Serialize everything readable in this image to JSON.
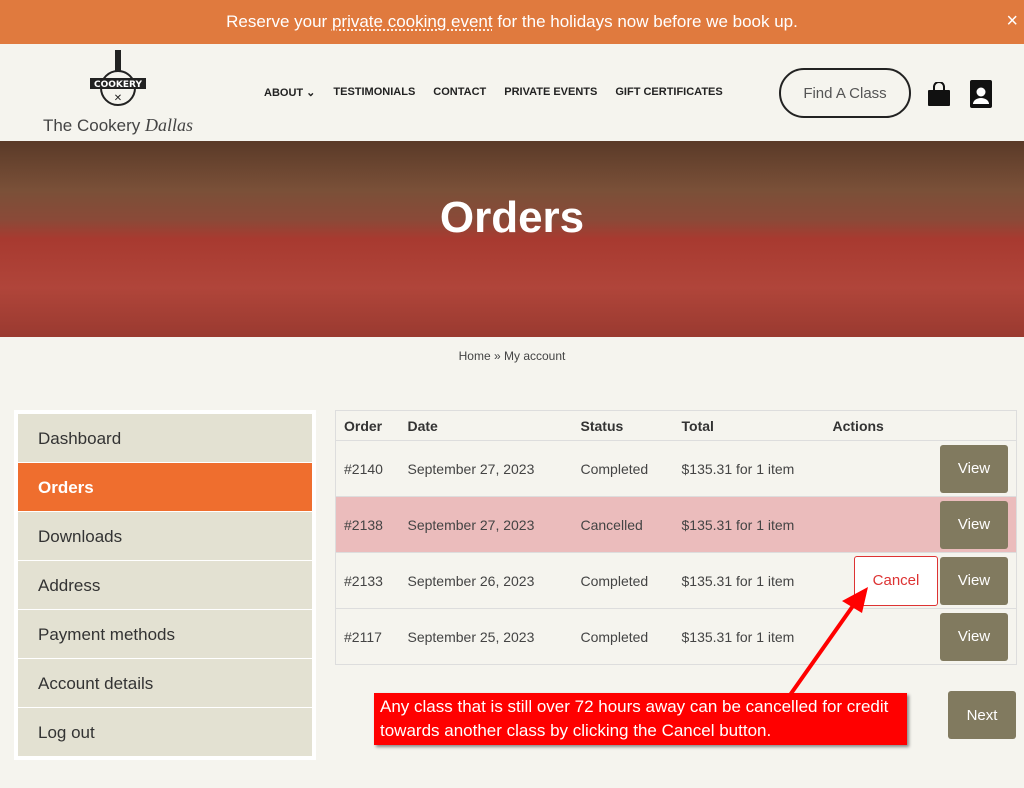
{
  "banner": {
    "pre": "Reserve your ",
    "link": "private cooking event",
    "post": " for the holidays now before we book up.",
    "close": "×"
  },
  "logo": {
    "badge": "COOKERY",
    "name": "The Cookery ",
    "city": "Dallas"
  },
  "nav": [
    "ABOUT ⌄",
    "TESTIMONIALS",
    "CONTACT",
    "PRIVATE EVENTS",
    "GIFT CERTIFICATES"
  ],
  "find_class": "Find A Class",
  "hero_title": "Orders",
  "breadcrumb": "Home » My account",
  "sidebar": [
    "Dashboard",
    "Orders",
    "Downloads",
    "Address",
    "Payment methods",
    "Account details",
    "Log out"
  ],
  "table": {
    "headers": [
      "Order",
      "Date",
      "Status",
      "Total",
      "Actions"
    ],
    "rows": [
      {
        "order": "#2140",
        "date": "September 27, 2023",
        "status": "Completed",
        "total": "$135.31 for 1 item"
      },
      {
        "order": "#2138",
        "date": "September 27, 2023",
        "status": "Cancelled",
        "total": "$135.31 for 1 item"
      },
      {
        "order": "#2133",
        "date": "September 26, 2023",
        "status": "Completed",
        "total": "$135.31 for 1 item",
        "cancel": "Cancel"
      },
      {
        "order": "#2117",
        "date": "September 25, 2023",
        "status": "Completed",
        "total": "$135.31 for 1 item"
      }
    ],
    "view": "View"
  },
  "next": "Next",
  "annotation": "Any class that is still over 72 hours away can be cancelled for credit towards another class by clicking the Cancel button."
}
